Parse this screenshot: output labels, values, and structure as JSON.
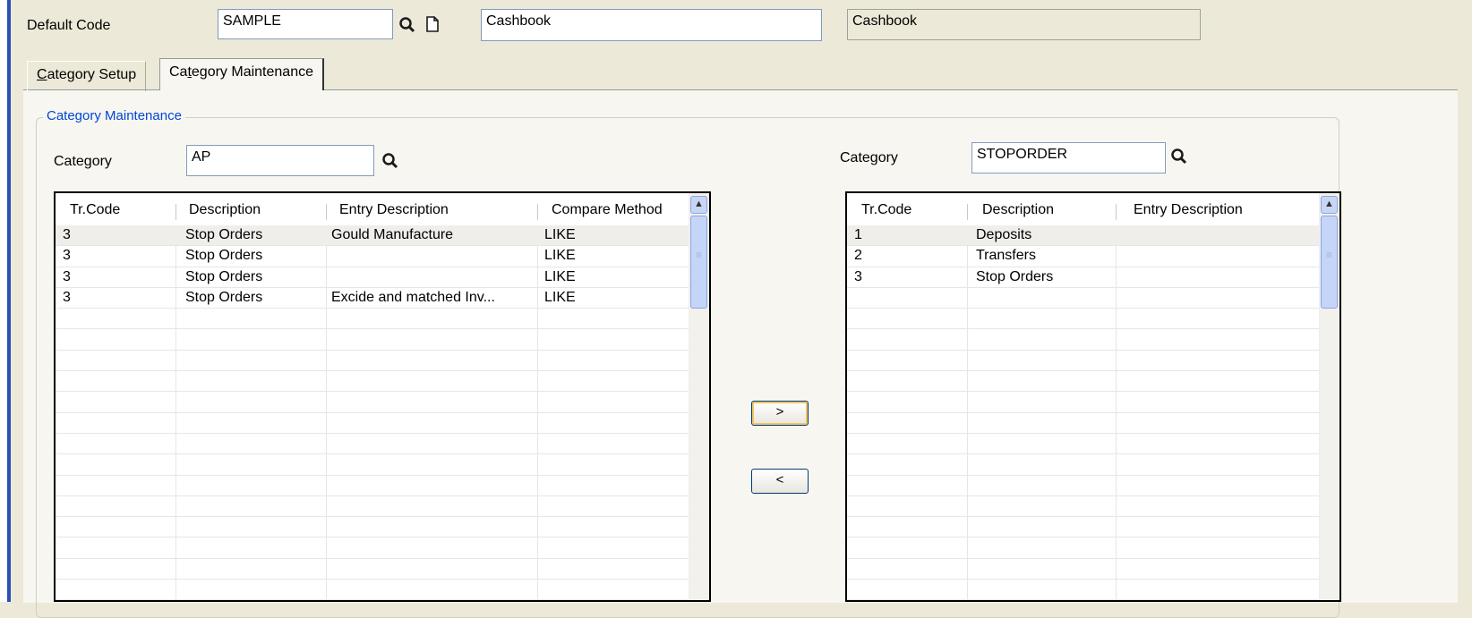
{
  "header": {
    "default_code_label": "Default Code",
    "default_code_value": "SAMPLE",
    "description_value": "Cashbook",
    "readonly_value": "Cashbook"
  },
  "tabs": [
    {
      "label_prefix": "",
      "label_underlined": "C",
      "label_rest": "ategory Setup",
      "active": false
    },
    {
      "label_prefix": "Ca",
      "label_underlined": "t",
      "label_rest": "egory Maintenance",
      "active": true
    }
  ],
  "group": {
    "title": "Category Maintenance"
  },
  "left": {
    "category_label": "Category",
    "category_value": "AP",
    "columns": [
      "Tr.Code",
      "Description",
      "Entry Description",
      "Compare Method"
    ],
    "rows": [
      [
        "3",
        "Stop Orders",
        "Gould Manufacture",
        "LIKE"
      ],
      [
        "3",
        "Stop Orders",
        "",
        "LIKE"
      ],
      [
        "3",
        "Stop Orders",
        "",
        "LIKE"
      ],
      [
        "3",
        "Stop Orders",
        "Excide and matched Inv...",
        "LIKE"
      ]
    ]
  },
  "right": {
    "category_label": "Category",
    "category_value": "STOPORDER",
    "columns": [
      "Tr.Code",
      "Description",
      "Entry Description"
    ],
    "rows": [
      [
        "1",
        "Deposits",
        ""
      ],
      [
        "2",
        "Transfers",
        ""
      ],
      [
        "3",
        "Stop Orders",
        ""
      ]
    ]
  },
  "buttons": {
    "move_right": ">",
    "move_left": "<"
  },
  "icons": {
    "search": "search-icon",
    "new": "new-document-icon",
    "scroll_up": "scroll-up-icon"
  }
}
